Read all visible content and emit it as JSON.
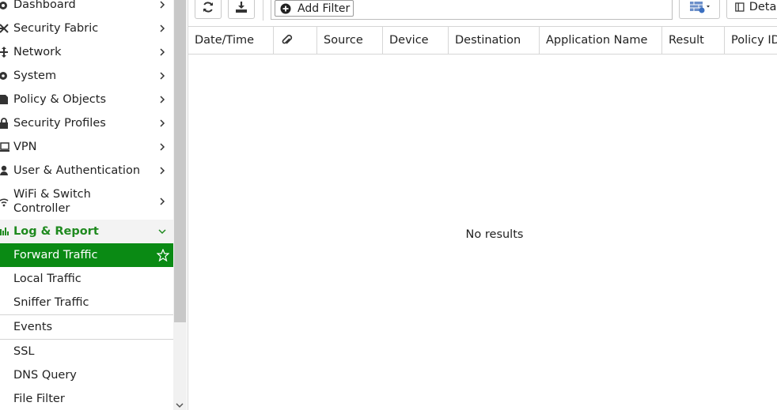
{
  "sidebar": {
    "items": [
      {
        "label": "Dashboard",
        "icon": "dashboard-icon"
      },
      {
        "label": "Security Fabric",
        "icon": "security-fabric-icon"
      },
      {
        "label": "Network",
        "icon": "network-icon"
      },
      {
        "label": "System",
        "icon": "gear-icon"
      },
      {
        "label": "Policy & Objects",
        "icon": "policy-icon"
      },
      {
        "label": "Security Profiles",
        "icon": "lock-icon"
      },
      {
        "label": "VPN",
        "icon": "laptop-icon"
      },
      {
        "label": "User & Authentication",
        "icon": "user-icon"
      },
      {
        "label_line1": "WiFi & Switch",
        "label_line2": "Controller",
        "icon": "wifi-icon"
      },
      {
        "label": "Log & Report",
        "icon": "bar-chart-icon"
      }
    ],
    "subitems": [
      {
        "label": "Forward Traffic",
        "selected": true
      },
      {
        "label": "Local Traffic"
      },
      {
        "label": "Sniffer Traffic"
      },
      {
        "label": "Events"
      },
      {
        "label": "SSL"
      },
      {
        "label": "DNS Query"
      },
      {
        "label": "File Filter"
      }
    ],
    "active_color": "#1f8a1f",
    "selected_bg": "#0a8a14"
  },
  "toolbar": {
    "refresh_icon": "refresh-icon",
    "download_icon": "download-icon",
    "add_filter_label": "Add Filter",
    "details_label": "Details"
  },
  "table": {
    "columns": [
      "Date/Time",
      "",
      "Source",
      "Device",
      "Destination",
      "Application Name",
      "Result",
      "Policy ID"
    ],
    "empty_text": "No results"
  }
}
